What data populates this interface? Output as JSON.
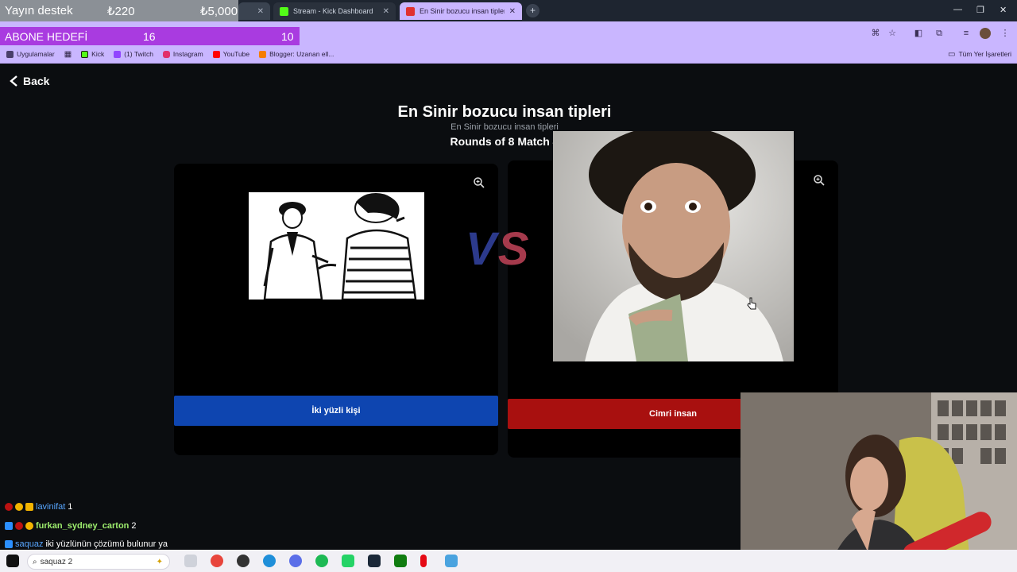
{
  "browser": {
    "tabs": [
      {
        "label": "Stream - Kick Dashboard",
        "favicon_color": "#53fc18"
      },
      {
        "label": "En Sinir bozucu insan tipleri | U",
        "favicon_color": "#e0312f",
        "active": true
      }
    ],
    "bookmarks": [
      {
        "label": "Uygulamalar",
        "icon": "apps-grid-icon",
        "color": "#4a3f6b"
      },
      {
        "label": "Kick",
        "icon": "kick-icon",
        "color": "#53fc18"
      },
      {
        "label": "(1) Twitch",
        "icon": "twitch-icon",
        "color": "#9146ff"
      },
      {
        "label": "Instagram",
        "icon": "instagram-icon",
        "color": "#e1306c"
      },
      {
        "label": "YouTube",
        "icon": "youtube-icon",
        "color": "#ff0000"
      },
      {
        "label": "Blogger: Uzanan ell...",
        "icon": "blogger-icon",
        "color": "#f57d00"
      }
    ],
    "all_bookmarks_label": "Tüm Yer İşaretleri"
  },
  "overlay": {
    "donation_label": "Yayın destek",
    "donation_current": "₺220",
    "donation_goal": "₺5,000",
    "sub_goal_label": "ABONE HEDEFİ",
    "sub_goal_current": "16",
    "sub_goal_target": "10"
  },
  "page": {
    "back_label": "Back",
    "title": "En Sinir bozucu insan tipleri",
    "subtitle": "En Sinir bozucu insan tipleri",
    "rounds": "Rounds of 8 Match 4",
    "vs_v": "V",
    "vs_s": "S",
    "left_choice": "İki yüzli kişi",
    "right_choice": "Cimri insan"
  },
  "chat": [
    {
      "user": "lavinifat",
      "message": "1"
    },
    {
      "user": "furkan_sydney_carton",
      "message": "2"
    },
    {
      "user": "saquaz",
      "message": "iki yüzlünün çözümü bulunur ya"
    }
  ],
  "taskbar": {
    "search_text": "saquaz 2"
  },
  "colors": {
    "accent_purple": "#c9b6ff",
    "left_button": "#0e45b0",
    "right_button": "#a8100f",
    "sub_goal": "#a93be0"
  }
}
